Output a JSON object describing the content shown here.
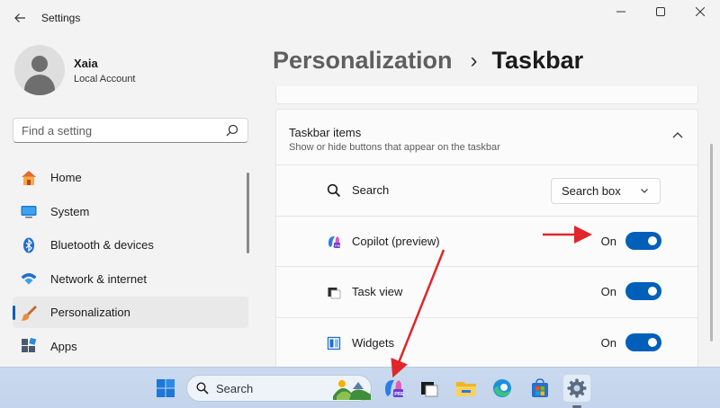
{
  "window": {
    "title": "Settings"
  },
  "profile": {
    "name": "Xaia",
    "account_type": "Local Account"
  },
  "search": {
    "placeholder": "Find a setting"
  },
  "sidebar": {
    "items": [
      {
        "label": "Home",
        "icon": "home-icon"
      },
      {
        "label": "System",
        "icon": "system-monitor-icon"
      },
      {
        "label": "Bluetooth & devices",
        "icon": "bluetooth-icon"
      },
      {
        "label": "Network & internet",
        "icon": "wifi-icon"
      },
      {
        "label": "Personalization",
        "icon": "paintbrush-icon",
        "active": true
      },
      {
        "label": "Apps",
        "icon": "apps-icon"
      }
    ]
  },
  "breadcrumb": {
    "parent": "Personalization",
    "separator": "›",
    "current": "Taskbar"
  },
  "taskbar_items": {
    "title": "Taskbar items",
    "description": "Show or hide buttons that appear on the taskbar",
    "rows": [
      {
        "label": "Search",
        "icon": "search-icon",
        "control": "dropdown",
        "value": "Search box"
      },
      {
        "label": "Copilot (preview)",
        "icon": "copilot-icon",
        "control": "toggle",
        "state": "On"
      },
      {
        "label": "Task view",
        "icon": "task-view-icon",
        "control": "toggle",
        "state": "On"
      },
      {
        "label": "Widgets",
        "icon": "widgets-icon",
        "control": "toggle",
        "state": "On"
      }
    ]
  },
  "taskbar": {
    "search_label": "Search",
    "apps": [
      "start-icon",
      "search-highlight-icon",
      "copilot-icon",
      "task-view-icon",
      "file-explorer-icon",
      "edge-icon",
      "store-icon",
      "settings-icon"
    ]
  },
  "colors": {
    "accent": "#005fb8",
    "annotation_arrow": "#e0262b"
  }
}
